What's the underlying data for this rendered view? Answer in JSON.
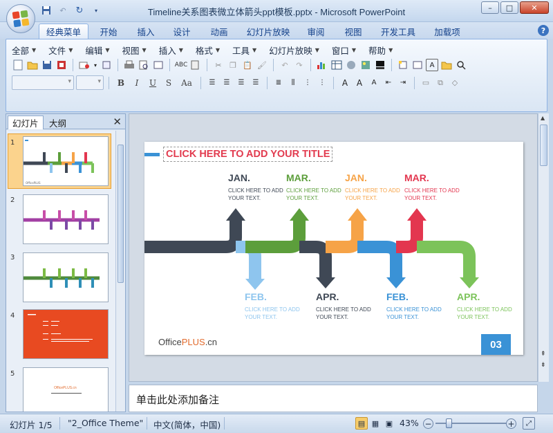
{
  "window": {
    "title": "Timeline关系图表微立体箭头ppt模板.pptx - Microsoft PowerPoint",
    "controls": [
      "minimize",
      "maximize",
      "close"
    ]
  },
  "qat": [
    "save-icon",
    "undo-icon",
    "redo-icon",
    "customize-icon"
  ],
  "ribbon_tabs": [
    "经典菜单",
    "开始",
    "插入",
    "设计",
    "动画",
    "幻灯片放映",
    "审阅",
    "视图",
    "开发工具",
    "加载项"
  ],
  "active_tab": "经典菜单",
  "classic_menus": [
    "全部",
    "文件",
    "编辑",
    "视图",
    "插入",
    "格式",
    "工具",
    "幻灯片放映",
    "窗口",
    "帮助"
  ],
  "left_panel": {
    "tabs": [
      "幻灯片",
      "大纲"
    ],
    "slide_numbers": [
      "1",
      "2",
      "3",
      "4",
      "5"
    ],
    "thumb5_text": "OfficePLUS.cn"
  },
  "slide": {
    "title": "CLICK HERE TO ADD YOUR TITLE",
    "logo_office": "Office",
    "logo_plus": "PLUS",
    "logo_cn": ".cn",
    "page_number": "03",
    "milestones": [
      {
        "month": "JAN.",
        "text": "CLICK HERE TO ADD YOUR TEXT.",
        "color": "#3f4855"
      },
      {
        "month": "MAR.",
        "text": "CLICK HERE TO ADD YOUR TEXT.",
        "color": "#5c9e3b"
      },
      {
        "month": "JAN.",
        "text": "CLICK HERE TO ADD YOUR TEXT.",
        "color": "#f6a347"
      },
      {
        "month": "MAR.",
        "text": "CLICK HERE TO ADD YOUR TEXT.",
        "color": "#e3364f"
      },
      {
        "month": "FEB.",
        "text": "CLICK HERE TO ADD YOUR TEXT.",
        "color": "#8ec5ee"
      },
      {
        "month": "APR.",
        "text": "CLICK HERE TO ADD YOUR TEXT.",
        "color": "#3f4855"
      },
      {
        "month": "FEB.",
        "text": "CLICK HERE TO ADD YOUR TEXT.",
        "color": "#3a92d6"
      },
      {
        "month": "APR.",
        "text": "CLICK HERE TO ADD YOUR TEXT.",
        "color": "#7cc35a"
      }
    ]
  },
  "notes_placeholder": "单击此处添加备注",
  "statusbar": {
    "slide_info": "幻灯片 1/5",
    "theme": "\"2_Office Theme\"",
    "language": "中文(简体，中国)",
    "zoom": "43%"
  }
}
